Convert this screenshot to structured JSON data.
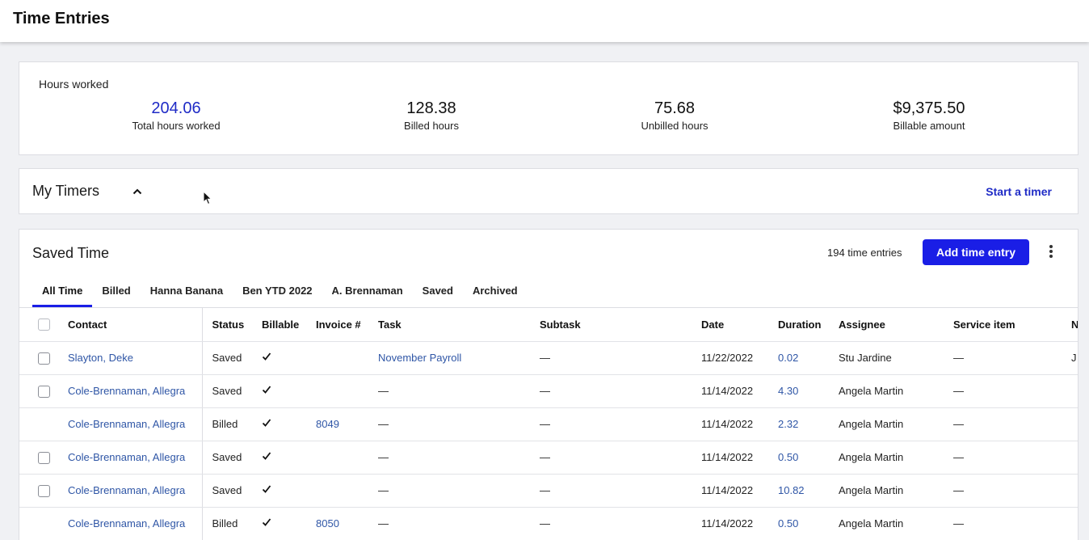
{
  "page": {
    "title": "Time Entries"
  },
  "hours": {
    "label": "Hours worked",
    "stats": [
      {
        "value": "204.06",
        "caption": "Total hours worked"
      },
      {
        "value": "128.38",
        "caption": "Billed hours"
      },
      {
        "value": "75.68",
        "caption": "Unbilled hours"
      },
      {
        "value": "$9,375.50",
        "caption": "Billable amount"
      }
    ]
  },
  "timers": {
    "title": "My Timers",
    "start_label": "Start a timer"
  },
  "saved": {
    "title": "Saved Time",
    "count": "194 time entries",
    "add_label": "Add time entry",
    "tabs": [
      "All Time",
      "Billed",
      "Hanna Banana",
      "Ben YTD 2022",
      "A. Brennaman",
      "Saved",
      "Archived"
    ],
    "columns": [
      "Contact",
      "Status",
      "Billable",
      "Invoice #",
      "Task",
      "Subtask",
      "Date",
      "Duration",
      "Assignee",
      "Service item",
      "N"
    ],
    "rows": [
      {
        "contact": "Slayton, Deke",
        "status": "Saved",
        "invoice": "",
        "task": "November Payroll",
        "subtask": "—",
        "date": "11/22/2022",
        "duration": "0.02",
        "assignee": "Stu Jardine",
        "service": "—",
        "extra": "J",
        "checkbox": true
      },
      {
        "contact": "Cole-Brennaman, Allegra",
        "status": "Saved",
        "invoice": "",
        "task": "—",
        "subtask": "—",
        "date": "11/14/2022",
        "duration": "4.30",
        "assignee": "Angela Martin",
        "service": "—",
        "extra": "",
        "checkbox": true
      },
      {
        "contact": "Cole-Brennaman, Allegra",
        "status": "Billed",
        "invoice": "8049",
        "task": "—",
        "subtask": "—",
        "date": "11/14/2022",
        "duration": "2.32",
        "assignee": "Angela Martin",
        "service": "—",
        "extra": "",
        "checkbox": false
      },
      {
        "contact": "Cole-Brennaman, Allegra",
        "status": "Saved",
        "invoice": "",
        "task": "—",
        "subtask": "—",
        "date": "11/14/2022",
        "duration": "0.50",
        "assignee": "Angela Martin",
        "service": "—",
        "extra": "",
        "checkbox": true
      },
      {
        "contact": "Cole-Brennaman, Allegra",
        "status": "Saved",
        "invoice": "",
        "task": "—",
        "subtask": "—",
        "date": "11/14/2022",
        "duration": "10.82",
        "assignee": "Angela Martin",
        "service": "—",
        "extra": "",
        "checkbox": true
      },
      {
        "contact": "Cole-Brennaman, Allegra",
        "status": "Billed",
        "invoice": "8050",
        "task": "—",
        "subtask": "—",
        "date": "11/14/2022",
        "duration": "0.50",
        "assignee": "Angela Martin",
        "service": "—",
        "extra": "",
        "checkbox": false
      }
    ]
  },
  "colors": {
    "accent": "#1a1ee6",
    "link": "#2f56a6",
    "stat_highlight": "#1f2bc6"
  }
}
